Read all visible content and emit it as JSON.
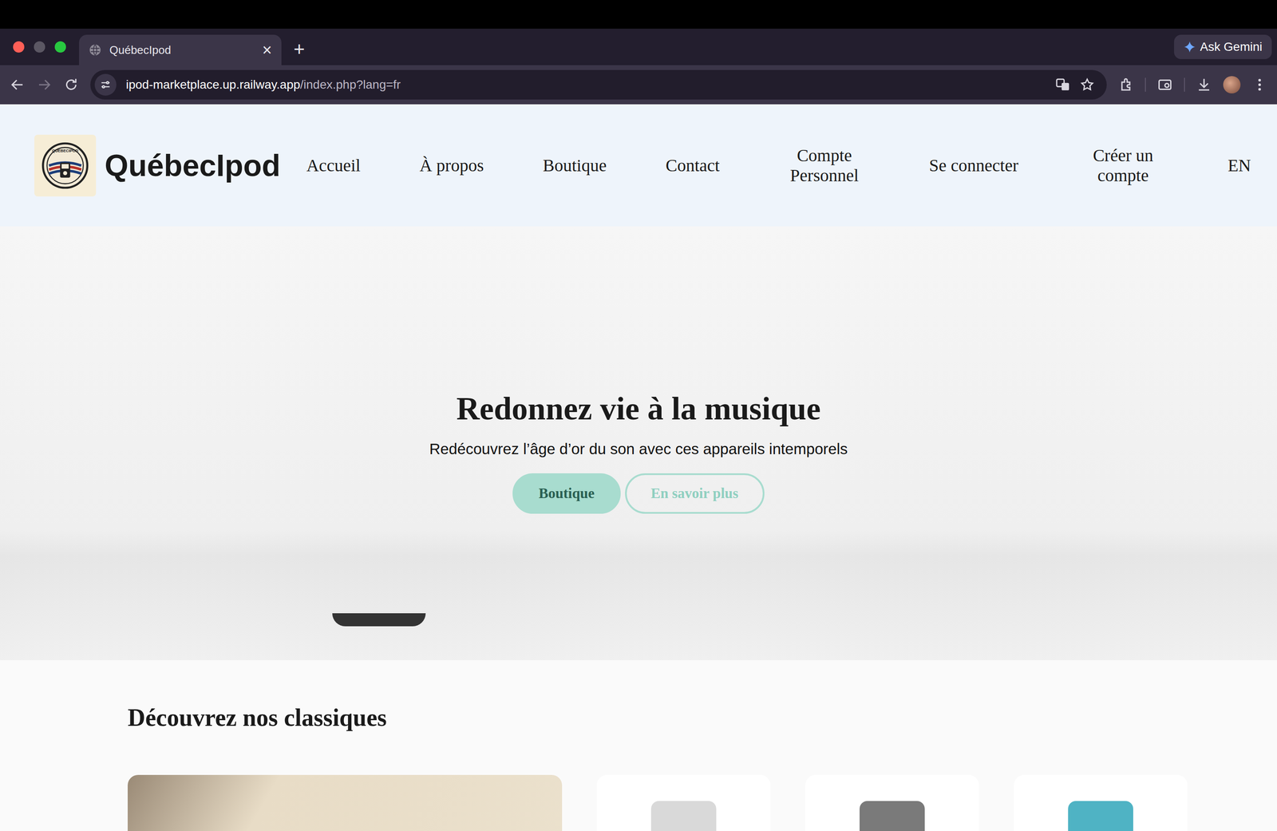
{
  "window": {
    "title": "QuébecIpod"
  },
  "tabs": [
    {
      "label": "QuébecIpod",
      "selected": true,
      "close": "×"
    }
  ],
  "new_tab": "+",
  "ask_gemini": "Ask Gemini",
  "address_bar": {
    "domain": "ipod-marketplace.up.railway.app",
    "path": "/index.php?lang=fr"
  },
  "navigation": {
    "back_disabled": false,
    "forward_disabled": true
  },
  "site": {
    "brand": "QuébecIpod",
    "logo_text": "QUÉBECIPOD",
    "nav": [
      {
        "label": "Accueil"
      },
      {
        "label": "À propos"
      },
      {
        "label": "Boutique"
      },
      {
        "label": "Contact"
      },
      {
        "label": "Compte Personnel"
      },
      {
        "label": "Se connecter"
      },
      {
        "label": "Créer un compte"
      }
    ],
    "language": "EN"
  },
  "hero": {
    "title": "Redonnez vie à la musique",
    "subtitle": "Redécouvrez l’âge d’or du son avec ces appareils intemporels",
    "buttons": [
      {
        "label": "Boutique",
        "kind": "filled"
      },
      {
        "label": "En savoir plus",
        "kind": "outline"
      }
    ]
  },
  "section": {
    "title": "Découvrez nos classiques",
    "cards": [
      {
        "kind": "featured"
      },
      {
        "kind": "product",
        "color": "#d9d9d9"
      },
      {
        "kind": "product",
        "color": "#7a7a7a"
      },
      {
        "kind": "product",
        "color": "#4fb3c4"
      }
    ]
  }
}
